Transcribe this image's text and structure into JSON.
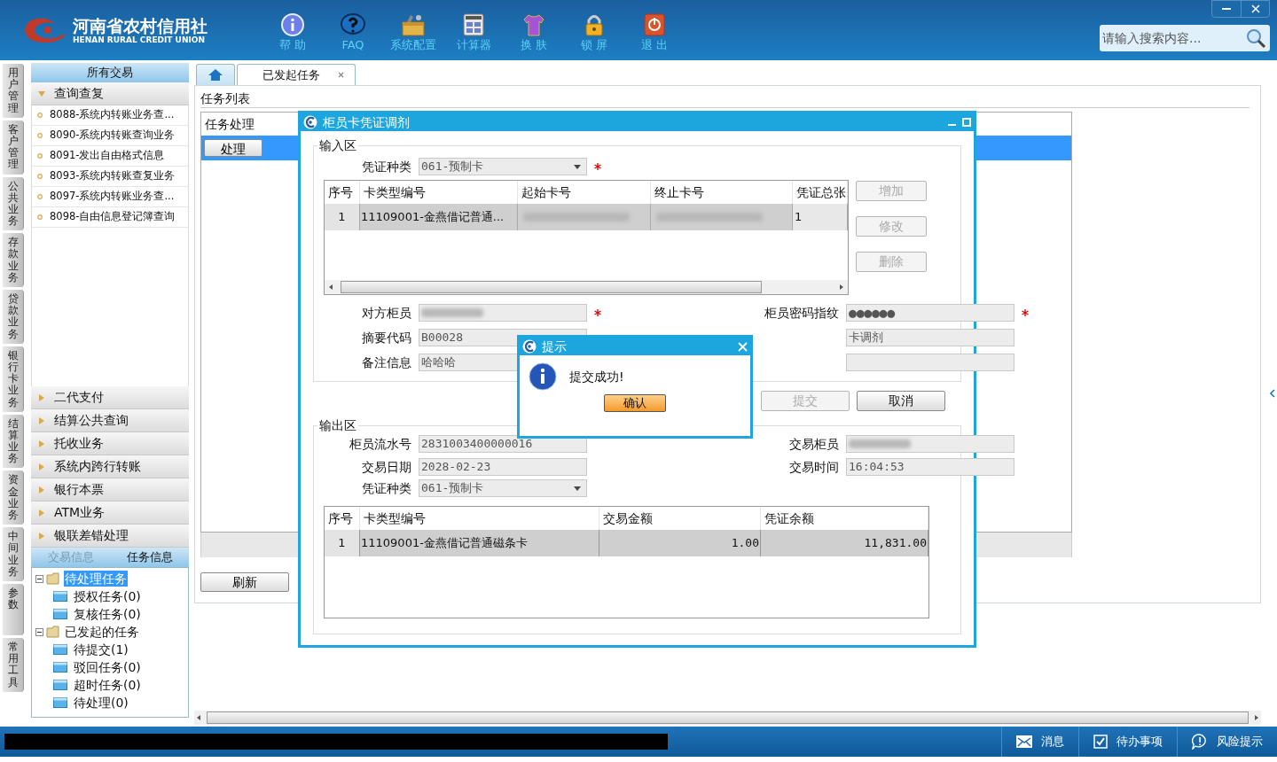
{
  "header": {
    "logo_title": "河南省农村信用社",
    "logo_subtitle": "HENAN RURAL CREDIT UNION",
    "toolbar": [
      {
        "label": "帮 助",
        "kind": "info"
      },
      {
        "label": "FAQ",
        "kind": "faq"
      },
      {
        "label": "系统配置",
        "kind": "config"
      },
      {
        "label": "计算器",
        "kind": "calc"
      },
      {
        "label": "换 肤",
        "kind": "skin"
      },
      {
        "label": "锁 屏",
        "kind": "lock"
      },
      {
        "label": "退 出",
        "kind": "exit"
      }
    ],
    "search": {
      "placeholder": "请输入搜索内容..."
    }
  },
  "side_tabs": [
    "用户管理",
    "客户管理",
    "公共业务",
    "存款业务",
    "贷款业务",
    "银行卡业务",
    "结算业务",
    "资金业务",
    "中间业务",
    "参数",
    "常用工具"
  ],
  "sidebar": {
    "title": "所有交易",
    "groups": [
      {
        "label": "查询查复",
        "expanded": true,
        "items": [
          "8088-系统内转账业务查...",
          "8090-系统内转账查询业务",
          "8091-发出自由格式信息",
          "8093-系统内转账查复业务",
          "8097-系统内转账业务查...",
          "8098-自由信息登记簿查询"
        ]
      },
      {
        "label": "二代支付",
        "expanded": false
      },
      {
        "label": "结算公共查询",
        "expanded": false
      },
      {
        "label": "托收业务",
        "expanded": false
      },
      {
        "label": "系统内跨行转账",
        "expanded": false
      },
      {
        "label": "银行本票",
        "expanded": false
      },
      {
        "label": "ATM业务",
        "expanded": false
      },
      {
        "label": "银联差错处理",
        "expanded": false
      }
    ]
  },
  "info_tabs": [
    {
      "label": "交易信息",
      "selected": false
    },
    {
      "label": "任务信息",
      "selected": true
    }
  ],
  "task_tree": [
    {
      "label": "待处理任务",
      "selected": true,
      "expanded": true,
      "children": [
        {
          "label": "授权任务(0)",
          "selected": false
        },
        {
          "label": "复核任务(0)",
          "selected": false
        }
      ]
    },
    {
      "label": "已发起的任务",
      "selected": false,
      "expanded": true,
      "children": [
        {
          "label": "待提交(1)",
          "selected": false
        },
        {
          "label": "驳回任务(0)",
          "selected": false
        },
        {
          "label": "超时任务(0)",
          "selected": false
        },
        {
          "label": "待处理(0)",
          "selected": false
        }
      ]
    }
  ],
  "tabs": [
    {
      "kind": "home",
      "selected": false
    },
    {
      "kind": "text",
      "label": "已发起任务",
      "selected": true
    }
  ],
  "task_list": {
    "title": "任务列表",
    "columns": [
      "任务处理"
    ],
    "rows": [
      {
        "action": "处理"
      }
    ],
    "refresh": "刷新"
  },
  "dialog": {
    "title": "柜员卡凭证调剂",
    "input_area": {
      "title": "输入区",
      "voucher_type": {
        "label": "凭证种类",
        "value": "061-预制卡",
        "required": true
      },
      "table": {
        "columns": [
          "序号",
          "卡类型编号",
          "起始卡号",
          "终止卡号",
          "凭证总张"
        ],
        "rows": [
          {
            "cells": [
              {
                "text": "1",
                "kind": "index"
              },
              {
                "text": "11109001-金燕借记普通...",
                "kind": "text"
              },
              {
                "kind": "blurred"
              },
              {
                "kind": "blurred"
              },
              {
                "text": "1",
                "kind": "text"
              }
            ]
          }
        ]
      },
      "side_buttons": [
        {
          "label": "增加",
          "disabled": true
        },
        {
          "label": "修改",
          "disabled": true
        },
        {
          "label": "删除",
          "disabled": true
        }
      ],
      "fields": [
        {
          "label": "对方柜员",
          "kind": "blurred",
          "required": true
        },
        {
          "label": "柜员密码指纹",
          "kind": "password",
          "value": "●●●●●●",
          "required": true
        },
        {
          "label": "摘要代码",
          "kind": "text",
          "value": "B00028",
          "required": false
        },
        {
          "kind": "text",
          "value": "卡调剂",
          "required": false
        },
        {
          "label": "备注信息",
          "kind": "text",
          "value": "哈哈哈",
          "required": false
        },
        {
          "kind": "text",
          "required": false
        }
      ]
    },
    "actions": [
      {
        "label": "提交",
        "disabled": true
      },
      {
        "label": "取消",
        "disabled": false
      }
    ],
    "output_area": {
      "title": "输出区",
      "fields": [
        {
          "label": "柜员流水号",
          "kind": "text",
          "value": "2831003400000016"
        },
        {
          "label": "交易柜员",
          "kind": "blurred"
        },
        {
          "label": "交易日期",
          "kind": "text",
          "value": "2028-02-23"
        },
        {
          "label": "交易时间",
          "kind": "text",
          "value": "16:04:53"
        },
        {
          "label": "凭证种类",
          "kind": "select",
          "value": "061-预制卡"
        }
      ],
      "table": {
        "columns": [
          "序号",
          "卡类型编号",
          "交易金额",
          "凭证余额"
        ],
        "rows": [
          {
            "cells": [
              "1",
              "11109001-金燕借记普通磁条卡",
              "1.00",
              "11,831.00"
            ]
          }
        ]
      }
    }
  },
  "prompt": {
    "title": "提示",
    "message": "提交成功!",
    "button": "确认"
  },
  "status_bar": [
    {
      "label": "消息",
      "kind": "message"
    },
    {
      "label": "待办事项",
      "kind": "todo"
    },
    {
      "label": "风险提示",
      "kind": "risk"
    }
  ]
}
